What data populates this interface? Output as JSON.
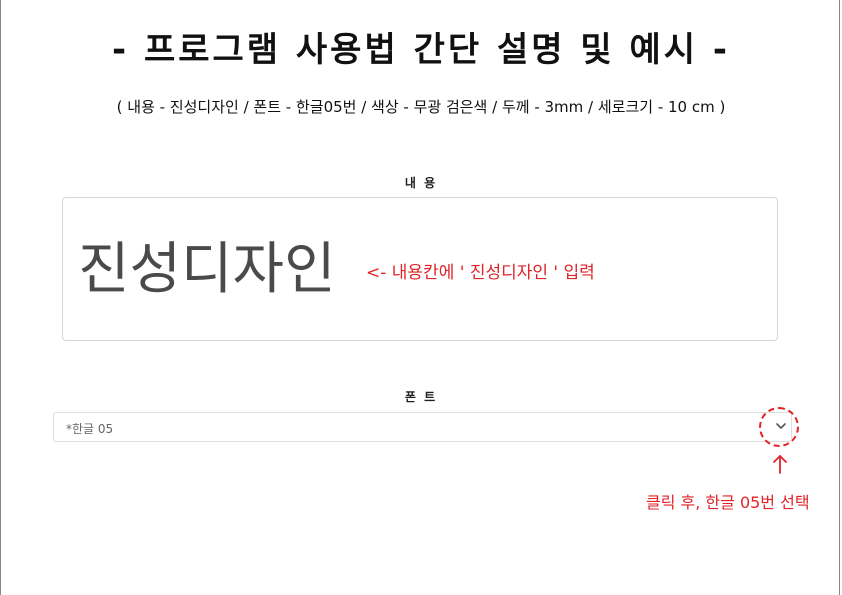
{
  "header": {
    "title": "- 프로그램 사용법 간단 설명 및 예시 -",
    "subtitle": "( 내용 - 진성디자인 / 폰트 - 한글05번 / 색상 - 무광 검은색 / 두께 - 3mm / 세로크기 - 10 cm )"
  },
  "content_section": {
    "label": "내 용",
    "value": "진성디자인",
    "annotation": "<- 내용칸에 ' 진성디자인 ' 입력"
  },
  "font_section": {
    "label": "폰 트",
    "selected_value": "*한글 05",
    "annotation": "클릭 후, 한글 05번 선택"
  },
  "icons": {
    "dropdown": "chevron-down-icon",
    "annotation_circle": "dashed-circle",
    "annotation_arrow": "arrow-up-icon"
  },
  "colors": {
    "annotation": "#e0242a",
    "content_text": "#4a4a4a"
  }
}
